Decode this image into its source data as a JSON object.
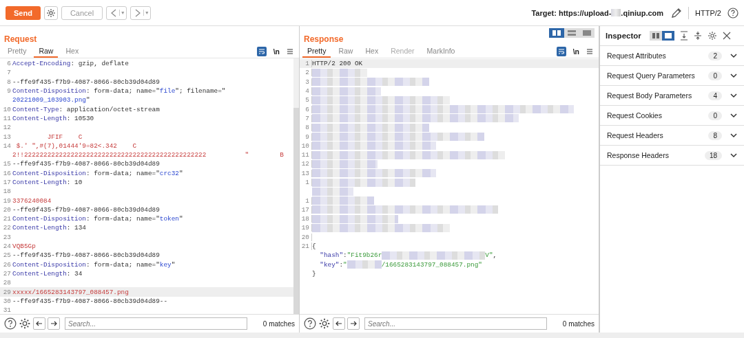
{
  "toolbar": {
    "send": "Send",
    "cancel": "Cancel",
    "back_caret": "▾",
    "forward_caret": "▾",
    "target_label": "Target:",
    "target_parts": [
      {
        "kind": "text",
        "text": "https://upload-"
      },
      {
        "kind": "redacted"
      },
      {
        "kind": "text",
        "text": ".qiniup.com"
      }
    ],
    "protocol": "HTTP/2"
  },
  "request": {
    "title": "Request",
    "tabs": [
      {
        "label": "Pretty",
        "selected": false,
        "disabled": false
      },
      {
        "label": "Raw",
        "selected": true,
        "disabled": false
      },
      {
        "label": "Hex",
        "selected": false,
        "disabled": false
      }
    ],
    "newline_toggle": "\\n",
    "lines": [
      {
        "num": "6",
        "highlighted": false,
        "parts": [
          {
            "kind": "key",
            "text": "Accept-Encoding"
          },
          {
            "kind": "plain",
            "text": ": gzip, deflate"
          }
        ]
      },
      {
        "num": "7",
        "highlighted": false
      },
      {
        "num": "8",
        "highlighted": false,
        "parts": [
          {
            "kind": "plain",
            "text": "--ffe9f435-f7b9-4087-8066-80cb39d04d89"
          }
        ]
      },
      {
        "num": "9",
        "highlighted": false,
        "parts": [
          {
            "kind": "key",
            "text": "Content-Disposition"
          },
          {
            "kind": "plain",
            "text": ": form-data; name=\""
          },
          {
            "kind": "string",
            "text": "file"
          },
          {
            "kind": "plain",
            "text": "\"; filename=\""
          }
        ]
      },
      {
        "highlighted": false,
        "parts": [
          {
            "kind": "string",
            "text": "20221009_103903.png"
          },
          {
            "kind": "plain",
            "text": "\""
          }
        ]
      },
      {
        "num": "10",
        "highlighted": false,
        "parts": [
          {
            "kind": "key",
            "text": "Content-Type"
          },
          {
            "kind": "plain",
            "text": ": application/octet-stream"
          }
        ]
      },
      {
        "num": "11",
        "highlighted": false,
        "parts": [
          {
            "kind": "key",
            "text": "Content-Length"
          },
          {
            "kind": "plain",
            "text": ": 10530"
          }
        ]
      },
      {
        "num": "12",
        "highlighted": false
      },
      {
        "num": "13",
        "highlighted": false,
        "parts": [
          {
            "kind": "body",
            "text": "         JFIF    C"
          }
        ]
      },
      {
        "num": "14",
        "highlighted": false,
        "parts": [
          {
            "kind": "body",
            "text": " $.' \",#(7),01444'9=82<.342    C"
          }
        ]
      },
      {
        "highlighted": false,
        "parts": [
          {
            "kind": "body",
            "text": "2!!22222222222222222222222222222222222222222222222          \"        B"
          }
        ]
      },
      {
        "num": "15",
        "highlighted": false,
        "parts": [
          {
            "kind": "plain",
            "text": "--ffe9f435-f7b9-4087-8066-80cb39d04d89"
          }
        ]
      },
      {
        "num": "16",
        "highlighted": false,
        "parts": [
          {
            "kind": "key",
            "text": "Content-Disposition"
          },
          {
            "kind": "plain",
            "text": ": form-data; name=\""
          },
          {
            "kind": "string",
            "text": "crc32"
          },
          {
            "kind": "plain",
            "text": "\""
          }
        ]
      },
      {
        "num": "17",
        "highlighted": false,
        "parts": [
          {
            "kind": "key",
            "text": "Content-Length"
          },
          {
            "kind": "plain",
            "text": ": 10"
          }
        ]
      },
      {
        "num": "18",
        "highlighted": false
      },
      {
        "num": "19",
        "highlighted": false,
        "parts": [
          {
            "kind": "body",
            "text": "3376240084"
          }
        ]
      },
      {
        "num": "20",
        "highlighted": false,
        "parts": [
          {
            "kind": "plain",
            "text": "--ffe9f435-f7b9-4087-8066-80cb39d04d89"
          }
        ]
      },
      {
        "num": "21",
        "highlighted": false,
        "parts": [
          {
            "kind": "key",
            "text": "Content-Disposition"
          },
          {
            "kind": "plain",
            "text": ": form-data; name=\""
          },
          {
            "kind": "string",
            "text": "token"
          },
          {
            "kind": "plain",
            "text": "\""
          }
        ]
      },
      {
        "num": "22",
        "highlighted": false,
        "parts": [
          {
            "kind": "key",
            "text": "Content-Length"
          },
          {
            "kind": "plain",
            "text": ": 134"
          }
        ]
      },
      {
        "num": "23",
        "highlighted": false
      },
      {
        "num": "24",
        "highlighted": false,
        "parts": [
          {
            "kind": "body",
            "text": "VQB5Gp"
          }
        ]
      },
      {
        "num": "25",
        "highlighted": false,
        "parts": [
          {
            "kind": "plain",
            "text": "--ffe9f435-f7b9-4087-8066-80cb39d04d89"
          }
        ]
      },
      {
        "num": "26",
        "highlighted": false,
        "parts": [
          {
            "kind": "key",
            "text": "Content-Disposition"
          },
          {
            "kind": "plain",
            "text": ": form-data; name=\""
          },
          {
            "kind": "string",
            "text": "key"
          },
          {
            "kind": "plain",
            "text": "\""
          }
        ]
      },
      {
        "num": "27",
        "highlighted": false,
        "parts": [
          {
            "kind": "key",
            "text": "Content-Length"
          },
          {
            "kind": "plain",
            "text": ": 34"
          }
        ]
      },
      {
        "num": "28",
        "highlighted": false
      },
      {
        "num": "29",
        "highlighted": true,
        "parts": [
          {
            "kind": "body",
            "text": "xxxxx/1665283143797_088457.png"
          }
        ]
      },
      {
        "num": "30",
        "highlighted": false,
        "parts": [
          {
            "kind": "plain",
            "text": "--ffe9f435-f7b9-4087-8066-80cb39d04d89--"
          }
        ]
      },
      {
        "num": "31",
        "highlighted": false
      }
    ],
    "search": {
      "placeholder": "Search...",
      "matches": "0 matches"
    }
  },
  "response": {
    "title": "Response",
    "layouts": [
      {
        "selected": true
      },
      {
        "selected": false
      },
      {
        "selected": false
      }
    ],
    "tabs": [
      {
        "label": "Pretty",
        "selected": true,
        "disabled": false
      },
      {
        "label": "Raw",
        "selected": false,
        "disabled": false
      },
      {
        "label": "Hex",
        "selected": false,
        "disabled": false
      },
      {
        "label": "Render",
        "selected": false,
        "disabled": true
      },
      {
        "label": "MarkInfo",
        "selected": false,
        "disabled": false
      }
    ],
    "newline_toggle": "\\n",
    "lines": [
      {
        "num": "1",
        "highlighted": true,
        "parts": [
          {
            "kind": "plain",
            "text": "HTTP/2 200 OK"
          }
        ]
      },
      {
        "num": "2",
        "highlighted": false,
        "parts": [
          {
            "kind": "redacted"
          }
        ]
      },
      {
        "num": "3",
        "highlighted": false,
        "parts": [
          {
            "kind": "redacted"
          }
        ]
      },
      {
        "num": "4",
        "highlighted": false,
        "parts": [
          {
            "kind": "redacted"
          }
        ]
      },
      {
        "num": "5",
        "highlighted": false,
        "parts": [
          {
            "kind": "redacted"
          }
        ]
      },
      {
        "num": "6",
        "highlighted": false,
        "parts": [
          {
            "kind": "redacted"
          }
        ]
      },
      {
        "num": "7",
        "highlighted": false,
        "parts": [
          {
            "kind": "redacted"
          }
        ]
      },
      {
        "num": "8",
        "highlighted": false,
        "parts": [
          {
            "kind": "redacted"
          }
        ]
      },
      {
        "num": "9",
        "highlighted": false,
        "parts": [
          {
            "kind": "redacted"
          }
        ]
      },
      {
        "num": "10",
        "highlighted": false,
        "parts": [
          {
            "kind": "redacted"
          }
        ]
      },
      {
        "num": "11",
        "highlighted": false,
        "parts": [
          {
            "kind": "redacted"
          }
        ]
      },
      {
        "num": "12",
        "highlighted": false,
        "parts": [
          {
            "kind": "redacted"
          }
        ]
      },
      {
        "num": "13",
        "highlighted": false,
        "parts": [
          {
            "kind": "redacted"
          }
        ]
      },
      {
        "num": "1",
        "highlighted": false,
        "parts": [
          {
            "kind": "redacted"
          }
        ]
      },
      {
        "highlighted": false,
        "parts": [
          {
            "kind": "redacted"
          }
        ]
      },
      {
        "num": "1",
        "highlighted": false,
        "parts": [
          {
            "kind": "redacted"
          }
        ]
      },
      {
        "num": "17",
        "highlighted": false,
        "parts": [
          {
            "kind": "redacted"
          }
        ]
      },
      {
        "num": "18",
        "highlighted": false,
        "parts": [
          {
            "kind": "redacted"
          }
        ]
      },
      {
        "num": "19",
        "highlighted": false,
        "parts": [
          {
            "kind": "redacted"
          }
        ]
      },
      {
        "num": "20",
        "highlighted": false
      },
      {
        "num": "21",
        "highlighted": false,
        "parts": [
          {
            "kind": "plain",
            "text": "{"
          }
        ]
      },
      {
        "highlighted": false,
        "parts": [
          {
            "kind": "json-key",
            "text": "  \"hash\""
          },
          {
            "kind": "plain",
            "text": ":"
          },
          {
            "kind": "json-value",
            "text": "\"Fit9b26r"
          },
          {
            "kind": "redacted"
          },
          {
            "kind": "json-value",
            "text": "V\""
          },
          {
            "kind": "plain",
            "text": ","
          }
        ]
      },
      {
        "highlighted": false,
        "parts": [
          {
            "kind": "json-key",
            "text": "  \"key\""
          },
          {
            "kind": "plain",
            "text": ":"
          },
          {
            "kind": "json-value",
            "text": "\""
          },
          {
            "kind": "redacted"
          },
          {
            "kind": "json-value",
            "text": "/1665283143797_088457.png\""
          }
        ]
      },
      {
        "highlighted": false,
        "parts": [
          {
            "kind": "plain",
            "text": "}"
          }
        ]
      }
    ],
    "search": {
      "placeholder": "Search...",
      "matches": "0 matches"
    }
  },
  "inspector": {
    "title": "Inspector",
    "layouts": [
      {
        "selected": false
      },
      {
        "selected": true
      }
    ],
    "sections": [
      {
        "name": "Request Attributes",
        "count": "2",
        "expanded": false
      },
      {
        "name": "Request Query Parameters",
        "count": "0",
        "expanded": false
      },
      {
        "name": "Request Body Parameters",
        "count": "4",
        "expanded": false
      },
      {
        "name": "Request Cookies",
        "count": "0",
        "expanded": false
      },
      {
        "name": "Request Headers",
        "count": "8",
        "expanded": false
      },
      {
        "name": "Response Headers",
        "count": "18",
        "expanded": false
      }
    ]
  }
}
